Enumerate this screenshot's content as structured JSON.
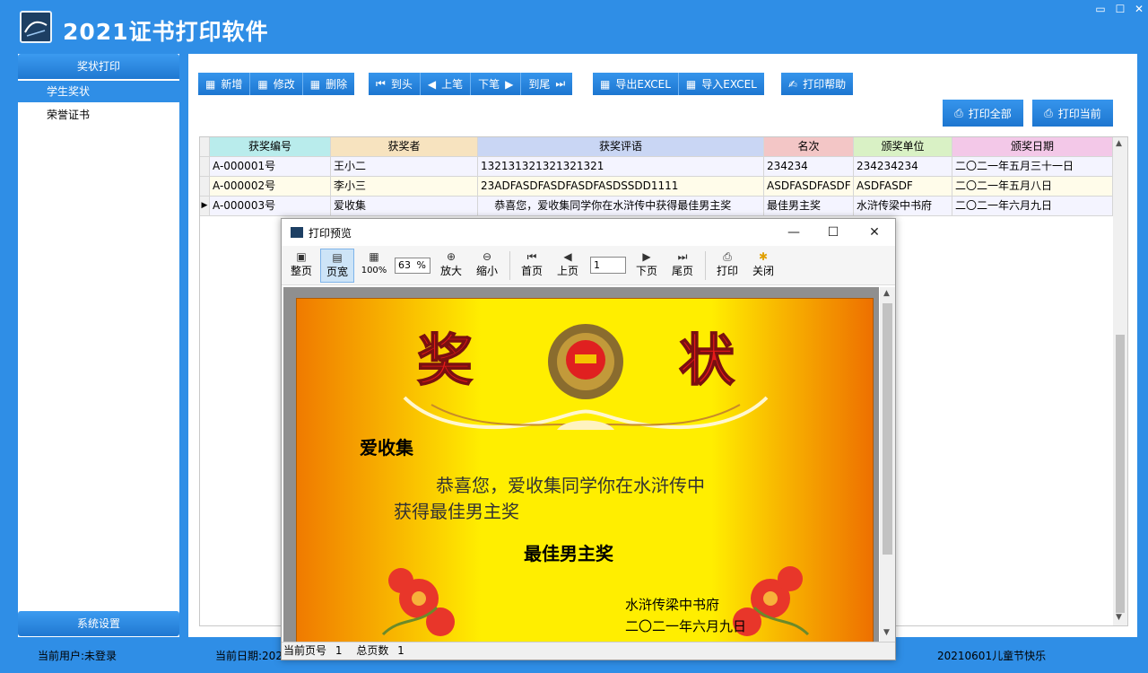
{
  "app": {
    "title": "2021证书打印软件"
  },
  "window_controls": {
    "minimize": "▭",
    "maximize": "☐",
    "close": "✕"
  },
  "sidebar": {
    "header": "奖状打印",
    "items": [
      {
        "label": "学生奖状",
        "active": true
      },
      {
        "label": "荣誉证书",
        "active": false
      }
    ],
    "footer": "系统设置"
  },
  "toolbar": {
    "new": "新增",
    "edit": "修改",
    "delete": "删除",
    "first": "到头",
    "prev": "上笔",
    "next": "下笔",
    "last": "到尾",
    "export_excel": "导出EXCEL",
    "import_excel": "导入EXCEL",
    "print_help": "打印帮助",
    "print_all": "打印全部",
    "print_current": "打印当前"
  },
  "grid": {
    "columns": [
      "获奖编号",
      "获奖者",
      "获奖评语",
      "名次",
      "颁奖单位",
      "颁奖日期"
    ],
    "header_colors": [
      "#b9ecec",
      "#f7e3bf",
      "#c9d6f4",
      "#f3c6c6",
      "#d9f1c5",
      "#f3c8e8"
    ],
    "rows": [
      [
        "A-000001号",
        "王小二",
        "132131321321321321",
        "234234",
        "234234234",
        "二〇二一年五月三十一日"
      ],
      [
        "A-000002号",
        "李小三",
        "23ADFASDFASDFASDFASDSSDD1111",
        "ASDFASDFASDF",
        "ASDFASDF",
        "二〇二一年五月八日"
      ],
      [
        "A-000003号",
        "爱收集",
        "    恭喜您，爱收集同学你在水浒传中获得最佳男主奖",
        "最佳男主奖",
        "水浒传梁中书府",
        "二〇二一年六月九日"
      ]
    ]
  },
  "status": {
    "user": "当前用户:未登录",
    "date": "当前日期:202",
    "message": "20210601儿童节快乐"
  },
  "preview": {
    "title": "打印预览",
    "controls": {
      "minimize": "—",
      "maximize": "☐",
      "close": "✕"
    },
    "toolbar": {
      "whole_page": "整页",
      "page_width": "页宽",
      "hundred": "100%",
      "zoom_value": "63",
      "zoom_unit": "%",
      "zoom_in": "放大",
      "zoom_out": "缩小",
      "first_page": "首页",
      "prev_page": "上页",
      "page_value": "1",
      "next_page": "下页",
      "last_page": "尾页",
      "print": "打印",
      "close": "关闭"
    },
    "certificate": {
      "name": "爱收集",
      "line1": "恭喜您，爱收集同学你在水浒传中",
      "line2": "获得最佳男主奖",
      "award": "最佳男主奖",
      "org": "水浒传梁中书府",
      "date": "二〇二一年六月九日"
    },
    "status_current_label": "当前页号",
    "status_current_value": "1",
    "status_total_label": "总页数",
    "status_total_value": "1"
  }
}
